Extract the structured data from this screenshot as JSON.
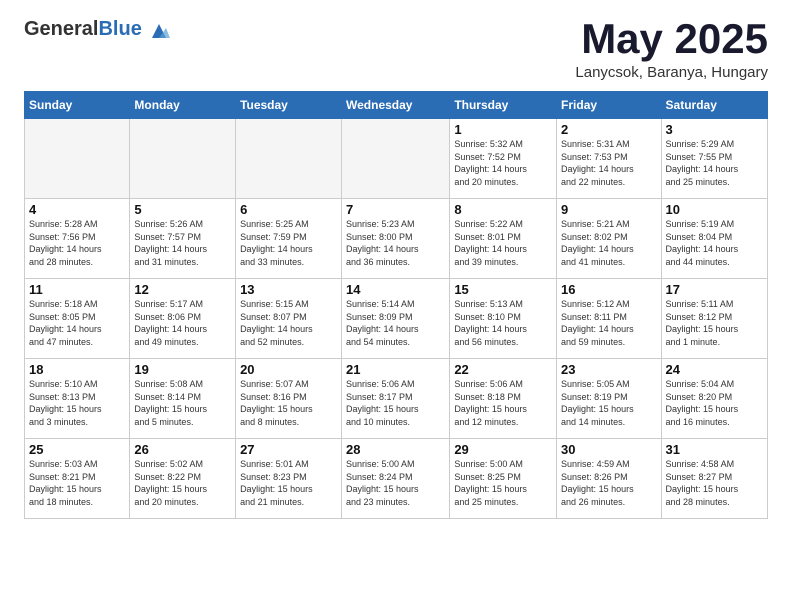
{
  "header": {
    "logo_general": "General",
    "logo_blue": "Blue",
    "month_title": "May 2025",
    "location": "Lanycsok, Baranya, Hungary"
  },
  "days_of_week": [
    "Sunday",
    "Monday",
    "Tuesday",
    "Wednesday",
    "Thursday",
    "Friday",
    "Saturday"
  ],
  "weeks": [
    [
      {
        "day": "",
        "empty": true
      },
      {
        "day": "",
        "empty": true
      },
      {
        "day": "",
        "empty": true
      },
      {
        "day": "",
        "empty": true
      },
      {
        "day": "1",
        "info": "Sunrise: 5:32 AM\nSunset: 7:52 PM\nDaylight: 14 hours\nand 20 minutes."
      },
      {
        "day": "2",
        "info": "Sunrise: 5:31 AM\nSunset: 7:53 PM\nDaylight: 14 hours\nand 22 minutes."
      },
      {
        "day": "3",
        "info": "Sunrise: 5:29 AM\nSunset: 7:55 PM\nDaylight: 14 hours\nand 25 minutes."
      }
    ],
    [
      {
        "day": "4",
        "info": "Sunrise: 5:28 AM\nSunset: 7:56 PM\nDaylight: 14 hours\nand 28 minutes."
      },
      {
        "day": "5",
        "info": "Sunrise: 5:26 AM\nSunset: 7:57 PM\nDaylight: 14 hours\nand 31 minutes."
      },
      {
        "day": "6",
        "info": "Sunrise: 5:25 AM\nSunset: 7:59 PM\nDaylight: 14 hours\nand 33 minutes."
      },
      {
        "day": "7",
        "info": "Sunrise: 5:23 AM\nSunset: 8:00 PM\nDaylight: 14 hours\nand 36 minutes."
      },
      {
        "day": "8",
        "info": "Sunrise: 5:22 AM\nSunset: 8:01 PM\nDaylight: 14 hours\nand 39 minutes."
      },
      {
        "day": "9",
        "info": "Sunrise: 5:21 AM\nSunset: 8:02 PM\nDaylight: 14 hours\nand 41 minutes."
      },
      {
        "day": "10",
        "info": "Sunrise: 5:19 AM\nSunset: 8:04 PM\nDaylight: 14 hours\nand 44 minutes."
      }
    ],
    [
      {
        "day": "11",
        "info": "Sunrise: 5:18 AM\nSunset: 8:05 PM\nDaylight: 14 hours\nand 47 minutes."
      },
      {
        "day": "12",
        "info": "Sunrise: 5:17 AM\nSunset: 8:06 PM\nDaylight: 14 hours\nand 49 minutes."
      },
      {
        "day": "13",
        "info": "Sunrise: 5:15 AM\nSunset: 8:07 PM\nDaylight: 14 hours\nand 52 minutes."
      },
      {
        "day": "14",
        "info": "Sunrise: 5:14 AM\nSunset: 8:09 PM\nDaylight: 14 hours\nand 54 minutes."
      },
      {
        "day": "15",
        "info": "Sunrise: 5:13 AM\nSunset: 8:10 PM\nDaylight: 14 hours\nand 56 minutes."
      },
      {
        "day": "16",
        "info": "Sunrise: 5:12 AM\nSunset: 8:11 PM\nDaylight: 14 hours\nand 59 minutes."
      },
      {
        "day": "17",
        "info": "Sunrise: 5:11 AM\nSunset: 8:12 PM\nDaylight: 15 hours\nand 1 minute."
      }
    ],
    [
      {
        "day": "18",
        "info": "Sunrise: 5:10 AM\nSunset: 8:13 PM\nDaylight: 15 hours\nand 3 minutes."
      },
      {
        "day": "19",
        "info": "Sunrise: 5:08 AM\nSunset: 8:14 PM\nDaylight: 15 hours\nand 5 minutes."
      },
      {
        "day": "20",
        "info": "Sunrise: 5:07 AM\nSunset: 8:16 PM\nDaylight: 15 hours\nand 8 minutes."
      },
      {
        "day": "21",
        "info": "Sunrise: 5:06 AM\nSunset: 8:17 PM\nDaylight: 15 hours\nand 10 minutes."
      },
      {
        "day": "22",
        "info": "Sunrise: 5:06 AM\nSunset: 8:18 PM\nDaylight: 15 hours\nand 12 minutes."
      },
      {
        "day": "23",
        "info": "Sunrise: 5:05 AM\nSunset: 8:19 PM\nDaylight: 15 hours\nand 14 minutes."
      },
      {
        "day": "24",
        "info": "Sunrise: 5:04 AM\nSunset: 8:20 PM\nDaylight: 15 hours\nand 16 minutes."
      }
    ],
    [
      {
        "day": "25",
        "info": "Sunrise: 5:03 AM\nSunset: 8:21 PM\nDaylight: 15 hours\nand 18 minutes."
      },
      {
        "day": "26",
        "info": "Sunrise: 5:02 AM\nSunset: 8:22 PM\nDaylight: 15 hours\nand 20 minutes."
      },
      {
        "day": "27",
        "info": "Sunrise: 5:01 AM\nSunset: 8:23 PM\nDaylight: 15 hours\nand 21 minutes."
      },
      {
        "day": "28",
        "info": "Sunrise: 5:00 AM\nSunset: 8:24 PM\nDaylight: 15 hours\nand 23 minutes."
      },
      {
        "day": "29",
        "info": "Sunrise: 5:00 AM\nSunset: 8:25 PM\nDaylight: 15 hours\nand 25 minutes."
      },
      {
        "day": "30",
        "info": "Sunrise: 4:59 AM\nSunset: 8:26 PM\nDaylight: 15 hours\nand 26 minutes."
      },
      {
        "day": "31",
        "info": "Sunrise: 4:58 AM\nSunset: 8:27 PM\nDaylight: 15 hours\nand 28 minutes."
      }
    ]
  ]
}
